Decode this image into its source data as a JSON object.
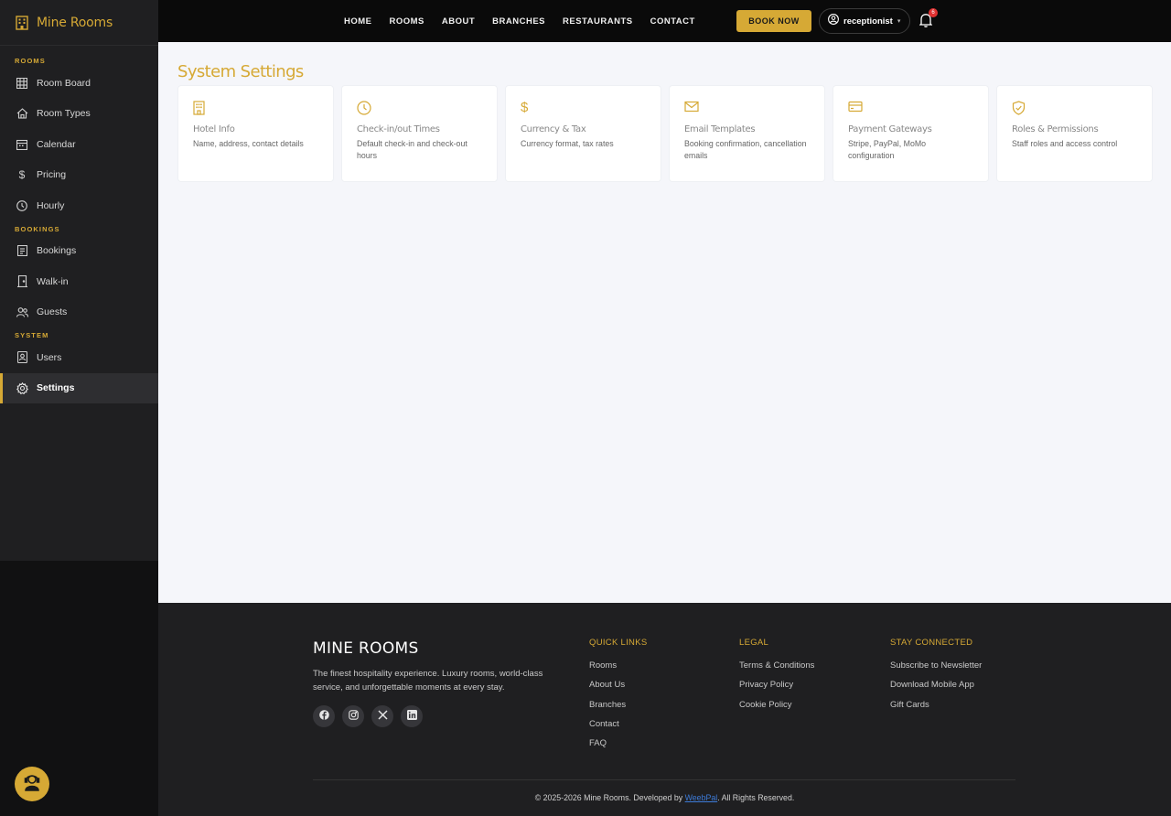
{
  "brand": {
    "name": "Mine Rooms"
  },
  "sidebar": {
    "sections": [
      {
        "title": "ROOMS",
        "items": [
          {
            "label": "Room Board",
            "icon": "grid-icon"
          },
          {
            "label": "Room Types",
            "icon": "home-icon"
          },
          {
            "label": "Calendar",
            "icon": "calendar-icon"
          },
          {
            "label": "Pricing",
            "icon": "dollar-icon"
          },
          {
            "label": "Hourly",
            "icon": "clock-icon"
          }
        ]
      },
      {
        "title": "BOOKINGS",
        "items": [
          {
            "label": "Bookings",
            "icon": "list-icon"
          },
          {
            "label": "Walk-in",
            "icon": "door-icon"
          },
          {
            "label": "Guests",
            "icon": "users-icon"
          }
        ]
      },
      {
        "title": "SYSTEM",
        "items": [
          {
            "label": "Users",
            "icon": "id-badge-icon"
          },
          {
            "label": "Settings",
            "icon": "gear-icon",
            "active": true
          }
        ]
      }
    ]
  },
  "topnav": {
    "links": [
      "HOME",
      "ROOMS",
      "ABOUT",
      "BRANCHES",
      "RESTAURANTS",
      "CONTACT"
    ],
    "book_label": "BOOK NOW",
    "user": "receptionist",
    "notifications": "6"
  },
  "main": {
    "title": "System Settings",
    "cards": [
      {
        "title": "Hotel Info",
        "desc": "Name, address, contact details",
        "icon": "building-icon"
      },
      {
        "title": "Check-in/out Times",
        "desc": "Default check-in and check-out hours",
        "icon": "clock-icon"
      },
      {
        "title": "Currency & Tax",
        "desc": "Currency format, tax rates",
        "icon": "dollar-icon"
      },
      {
        "title": "Email Templates",
        "desc": "Booking confirmation, cancellation emails",
        "icon": "envelope-icon"
      },
      {
        "title": "Payment Gateways",
        "desc": "Stripe, PayPal, MoMo configuration",
        "icon": "credit-card-icon"
      },
      {
        "title": "Roles & Permissions",
        "desc": "Staff roles and access control",
        "icon": "shield-check-icon"
      }
    ]
  },
  "footer": {
    "brand": "MINE ROOMS",
    "description": "The finest hospitality experience. Luxury rooms, world-class service, and unforgettable moments at every stay.",
    "socials": [
      "facebook-icon",
      "instagram-icon",
      "x-icon",
      "linkedin-icon"
    ],
    "columns": [
      {
        "heading": "QUICK LINKS",
        "links": [
          "Rooms",
          "About Us",
          "Branches",
          "Contact",
          "FAQ"
        ]
      },
      {
        "heading": "LEGAL",
        "links": [
          "Terms & Conditions",
          "Privacy Policy",
          "Cookie Policy"
        ]
      },
      {
        "heading": "STAY CONNECTED",
        "links": [
          "Subscribe to Newsletter",
          "Download Mobile App",
          "Gift Cards"
        ]
      }
    ],
    "copyright_prefix": "© 2025-2026 Mine Rooms. Developed by ",
    "developer": "WeebPal",
    "copyright_suffix": ". All Rights Reserved."
  },
  "colors": {
    "accent": "#d6a935",
    "sidebar": "#1f1f21",
    "topbar": "#0a0a0a",
    "content_bg": "#f5f6fa",
    "badge": "#e03131",
    "link": "#3d7bd8"
  }
}
